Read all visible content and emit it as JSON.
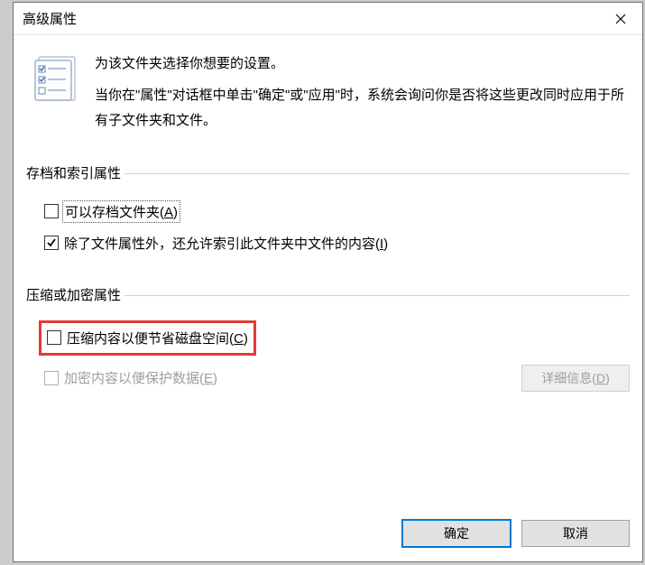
{
  "titlebar": {
    "title": "高级属性"
  },
  "intro": {
    "line1": "为该文件夹选择你想要的设置。",
    "line2": "当你在\"属性\"对话框中单击\"确定\"或\"应用\"时，系统会询问你是否将这些更改同时应用于所有子文件夹和文件。"
  },
  "group_archive": {
    "label": "存档和索引属性",
    "archive_checkbox_label_pre": "可以存档文件夹(",
    "archive_checkbox_key": "A",
    "archive_checkbox_label_post": ")",
    "archive_checked": false,
    "index_checkbox_label_pre": "除了文件属性外，还允许索引此文件夹中文件的内容(",
    "index_checkbox_key": "I",
    "index_checkbox_label_post": ")",
    "index_checked": true
  },
  "group_compress": {
    "label": "压缩或加密属性",
    "compress_checkbox_label_pre": "压缩内容以便节省磁盘空间(",
    "compress_checkbox_key": "C",
    "compress_checkbox_label_post": ")",
    "compress_checked": false,
    "encrypt_checkbox_label_pre": "加密内容以便保护数据(",
    "encrypt_checkbox_key": "E",
    "encrypt_checkbox_label_post": ")",
    "encrypt_checked": false,
    "encrypt_enabled": false,
    "details_btn_label_pre": "详细信息(",
    "details_btn_key": "D",
    "details_btn_label_post": ")",
    "details_enabled": false
  },
  "footer": {
    "ok_label": "确定",
    "cancel_label": "取消"
  }
}
